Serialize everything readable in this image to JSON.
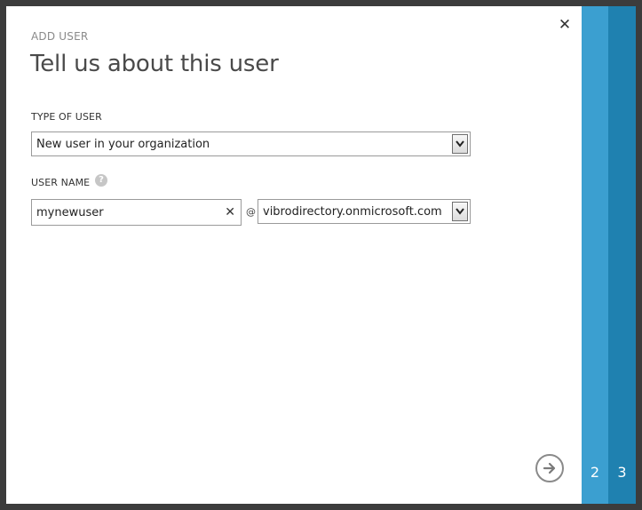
{
  "dialog": {
    "eyebrow": "ADD USER",
    "title": "Tell us about this user",
    "close_icon": "close-icon"
  },
  "type_of_user": {
    "label": "TYPE OF USER",
    "selected": "New user in your organization"
  },
  "user_name": {
    "label": "USER NAME",
    "help_icon": "question-mark-icon",
    "help_glyph": "?",
    "value": "mynewuser",
    "at": "@",
    "domain_selected": "vibrodirectory.onmicrosoft.com"
  },
  "steps": {
    "step2": "2",
    "step3": "3"
  },
  "colors": {
    "step2_bg": "#3b9fd0",
    "step3_bg": "#1f81b0"
  }
}
